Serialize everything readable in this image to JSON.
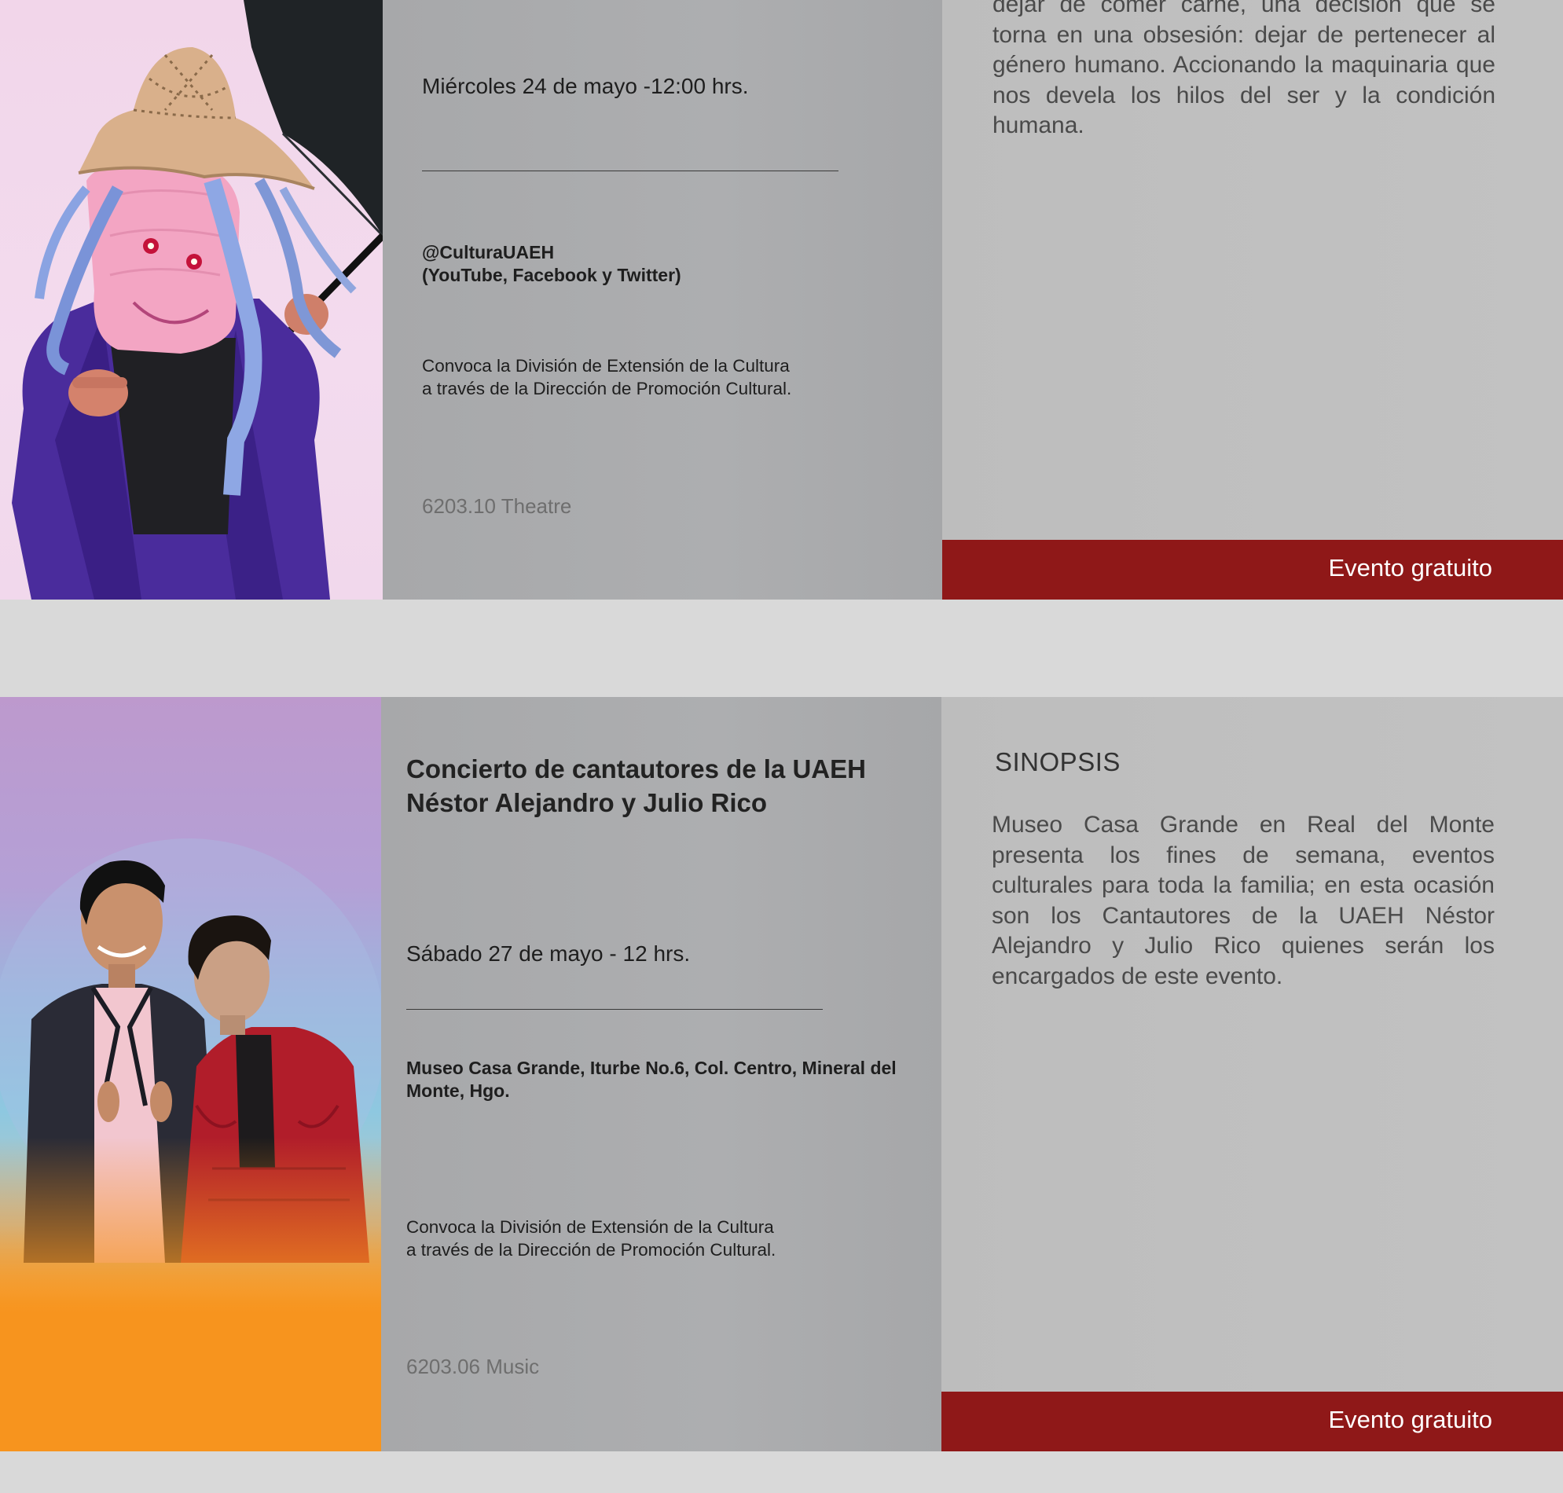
{
  "colors": {
    "page_background": "#d9d9d9",
    "info_panel": "#aaabad",
    "synopsis_panel": "#bfbfbf",
    "free_bar": "#8f1818",
    "category_text": "#6e6e6e"
  },
  "event1": {
    "synopsis_text": "dejar de comer carne, una decisión que se torna en una obsesión: dejar de pertenecer al género humano. Accionando la maquinaria que nos devela los hilos del ser y la condición humana.",
    "date": "Miércoles 24 de mayo -12:00 hrs.",
    "venue_line1": "@CulturaUAEH",
    "venue_line2": "(YouTube, Facebook y Twitter)",
    "organizer_line1": "Convoca la División de Extensión de la Cultura",
    "organizer_line2": "a través de la Dirección de Promoción Cultural.",
    "category": "6203.10 Theatre",
    "free_label": "Evento gratuito",
    "image_icon": "masked-performer-with-umbrella"
  },
  "event2": {
    "title_line1": "Concierto de cantautores de la UAEH",
    "title_line2": "Néstor Alejandro y Julio Rico",
    "date": "Sábado 27 de mayo - 12 hrs.",
    "venue": "Museo Casa Grande, Iturbe No.6, Col. Centro, Mineral del Monte, Hgo.",
    "organizer_line1": "Convoca la División de Extensión de la Cultura",
    "organizer_line2": "a través de la Dirección de Promoción Cultural.",
    "category": "6203.06 Music",
    "synopsis_heading": "SINOPSIS",
    "synopsis_text": "Museo Casa Grande en Real del Monte presenta los fines de semana, eventos culturales para toda la familia; en esta ocasión son los Cantautores de la UAEH Néstor Alejandro y Julio Rico quienes serán los encargados de este evento.",
    "free_label": "Evento gratuito",
    "image_icon": "two-singers-portrait"
  }
}
